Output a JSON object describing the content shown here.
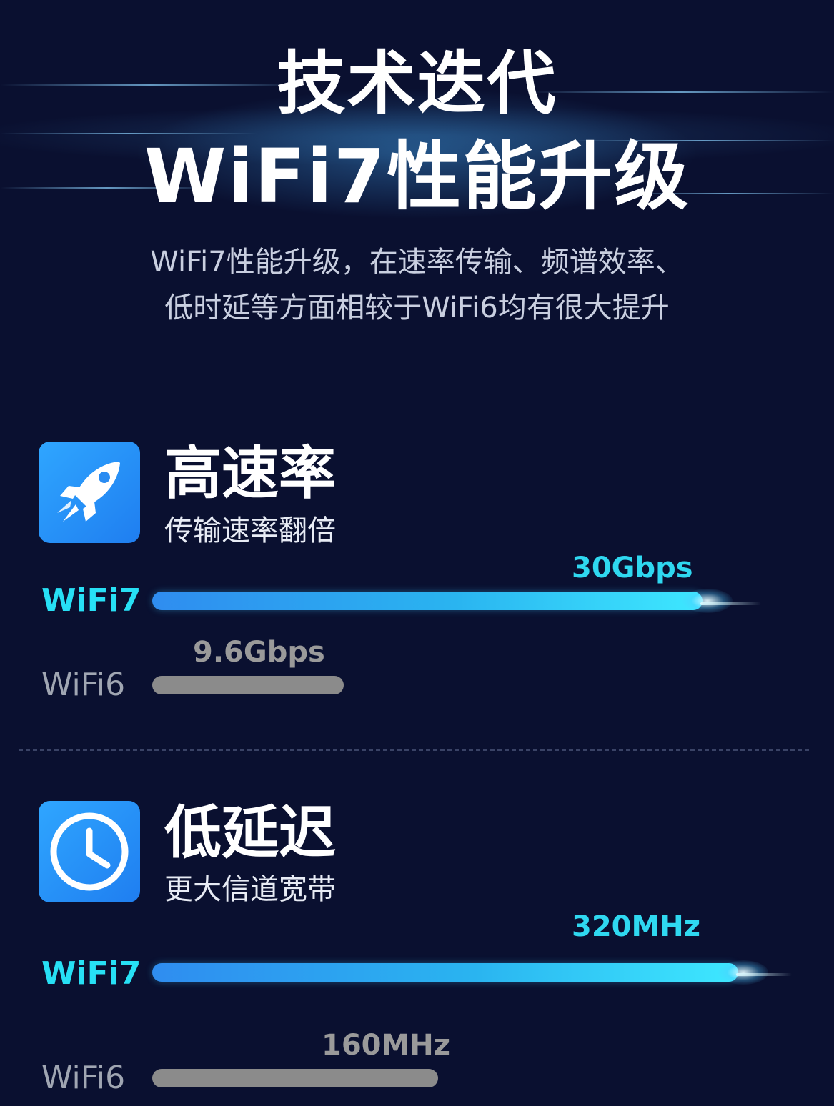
{
  "header": {
    "title_line1": "技术迭代",
    "title_line2": "WiFi7性能升级",
    "subtitle_line1": "WiFi7性能升级，在速率传输、频谱效率、",
    "subtitle_line2": "低时延等方面相较于WiFi6均有很大提升"
  },
  "features": [
    {
      "icon": "rocket-icon",
      "title": "高速率",
      "desc": "传输速率翻倍",
      "bars": [
        {
          "label": "WiFi7",
          "value": "30Gbps",
          "fill": 30
        },
        {
          "label": "WiFi6",
          "value": "9.6Gbps",
          "fill": 9.6
        }
      ]
    },
    {
      "icon": "clock-icon",
      "title": "低延迟",
      "desc": "更大信道宽带",
      "bars": [
        {
          "label": "WiFi7",
          "value": "320MHz",
          "fill": 320
        },
        {
          "label": "WiFi6",
          "value": "160MHz",
          "fill": 160
        }
      ]
    }
  ],
  "colors": {
    "background": "#0a1030",
    "wifi7_accent": "#27e0f5",
    "icon_blue": "#2196f3",
    "wifi6_gray": "#8b8b8b"
  }
}
